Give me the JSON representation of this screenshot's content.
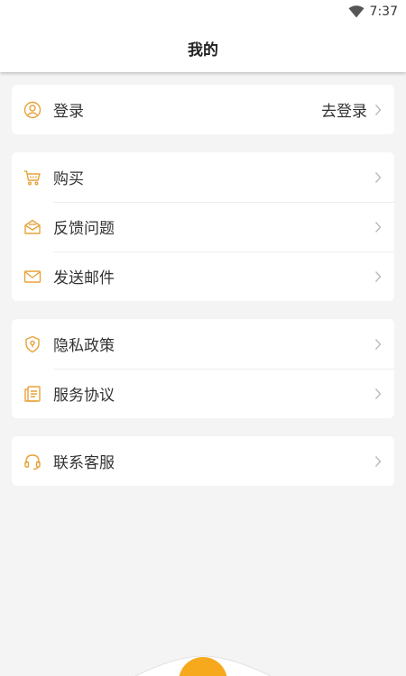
{
  "status_bar": {
    "time": "7:37"
  },
  "header": {
    "title": "我的"
  },
  "colors": {
    "accent": "#e8a23a",
    "fab": "#f7a91e"
  },
  "sections": [
    {
      "items": [
        {
          "icon": "user-circle-icon",
          "label": "登录",
          "value": "去登录"
        }
      ]
    },
    {
      "items": [
        {
          "icon": "cart-icon",
          "label": "购买"
        },
        {
          "icon": "feedback-envelope-icon",
          "label": "反馈问题"
        },
        {
          "icon": "mail-icon",
          "label": "发送邮件"
        }
      ]
    },
    {
      "items": [
        {
          "icon": "shield-icon",
          "label": "隐私政策"
        },
        {
          "icon": "document-icon",
          "label": "服务协议"
        }
      ]
    },
    {
      "items": [
        {
          "icon": "headset-icon",
          "label": "联系客服"
        }
      ]
    }
  ]
}
